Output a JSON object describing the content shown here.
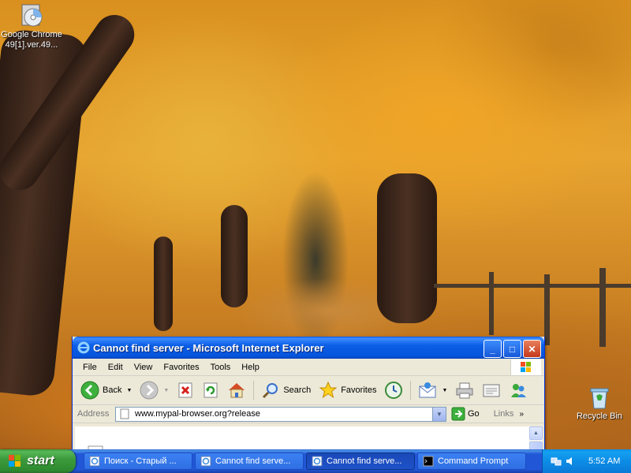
{
  "desktop": {
    "icons": [
      {
        "label": "Google Chrome 49[1].ver.49...",
        "icon": "cd-disc-icon"
      },
      {
        "label": "Recycle Bin",
        "icon": "recycle-bin-icon"
      }
    ]
  },
  "window": {
    "title": "Cannot find server - Microsoft Internet Explorer",
    "menu": [
      "File",
      "Edit",
      "View",
      "Favorites",
      "Tools",
      "Help"
    ],
    "toolbar": {
      "back_label": "Back",
      "search_label": "Search",
      "favorites_label": "Favorites"
    },
    "address": {
      "label": "Address",
      "value": "www.mypal-browser.org?release",
      "go_label": "Go",
      "links_label": "Links"
    }
  },
  "taskbar": {
    "start_label": "start",
    "tasks": [
      {
        "label": "Поиск - Старый ...",
        "icon": "ie-page-icon",
        "active": false
      },
      {
        "label": "Cannot find serve...",
        "icon": "ie-page-icon",
        "active": false
      },
      {
        "label": "Cannot find serve...",
        "icon": "ie-page-icon",
        "active": true
      },
      {
        "label": "Command Prompt",
        "icon": "cmd-icon",
        "active": false
      }
    ],
    "clock": "5:52 AM"
  },
  "colors": {
    "titlebar_blue": "#0654dc",
    "taskbar_blue": "#2157d7",
    "start_green": "#3c9a3c",
    "tray_blue": "#0d8de6"
  }
}
